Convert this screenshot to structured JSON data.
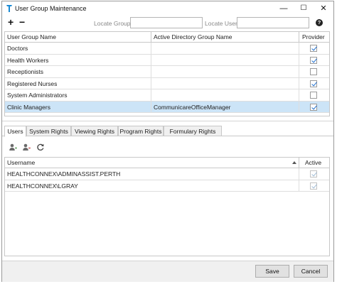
{
  "window": {
    "title": "User Group Maintenance",
    "minimize_glyph": "—",
    "maximize_glyph": "☐",
    "close_glyph": "✕"
  },
  "toolbar": {
    "add_glyph": "+",
    "remove_glyph": "−",
    "locate_group_label": "Locate Group",
    "locate_group_value": "",
    "locate_user_label": "Locate User",
    "locate_user_value": "",
    "help_glyph": "?"
  },
  "groups_grid": {
    "columns": [
      "User Group Name",
      "Active Directory Group Name",
      "Provider"
    ],
    "rows": [
      {
        "name": "Doctors",
        "ad_group": "",
        "provider": true
      },
      {
        "name": "Health Workers",
        "ad_group": "",
        "provider": true
      },
      {
        "name": "Receptionists",
        "ad_group": "",
        "provider": false
      },
      {
        "name": "Registered Nurses",
        "ad_group": "",
        "provider": true
      },
      {
        "name": "System Administrators",
        "ad_group": "",
        "provider": false
      },
      {
        "name": "Clinic Managers",
        "ad_group": "CommunicareOfficeManager",
        "provider": true
      }
    ],
    "selected_row": 5
  },
  "tabs": [
    {
      "label": "Users",
      "active": true
    },
    {
      "label": "System Rights",
      "active": false
    },
    {
      "label": "Viewing Rights",
      "active": false
    },
    {
      "label": "Program Rights",
      "active": false
    },
    {
      "label": "Formulary Rights",
      "active": false
    }
  ],
  "users_toolbar": {
    "icons": [
      "add-user-icon",
      "remove-user-icon",
      "refresh-icon"
    ]
  },
  "users_grid": {
    "columns": [
      "Username",
      "Active"
    ],
    "rows": [
      {
        "username": "HEALTHCONNEX\\ADMINASSIST.PERTH",
        "active": true
      },
      {
        "username": "HEALTHCONNEX\\LGRAY",
        "active": true
      }
    ]
  },
  "footer": {
    "save_label": "Save",
    "cancel_label": "Cancel"
  },
  "colors": {
    "selection": "#cce4f7",
    "check": "#1f6fcf",
    "brand_icon": "#1a8ad4"
  }
}
